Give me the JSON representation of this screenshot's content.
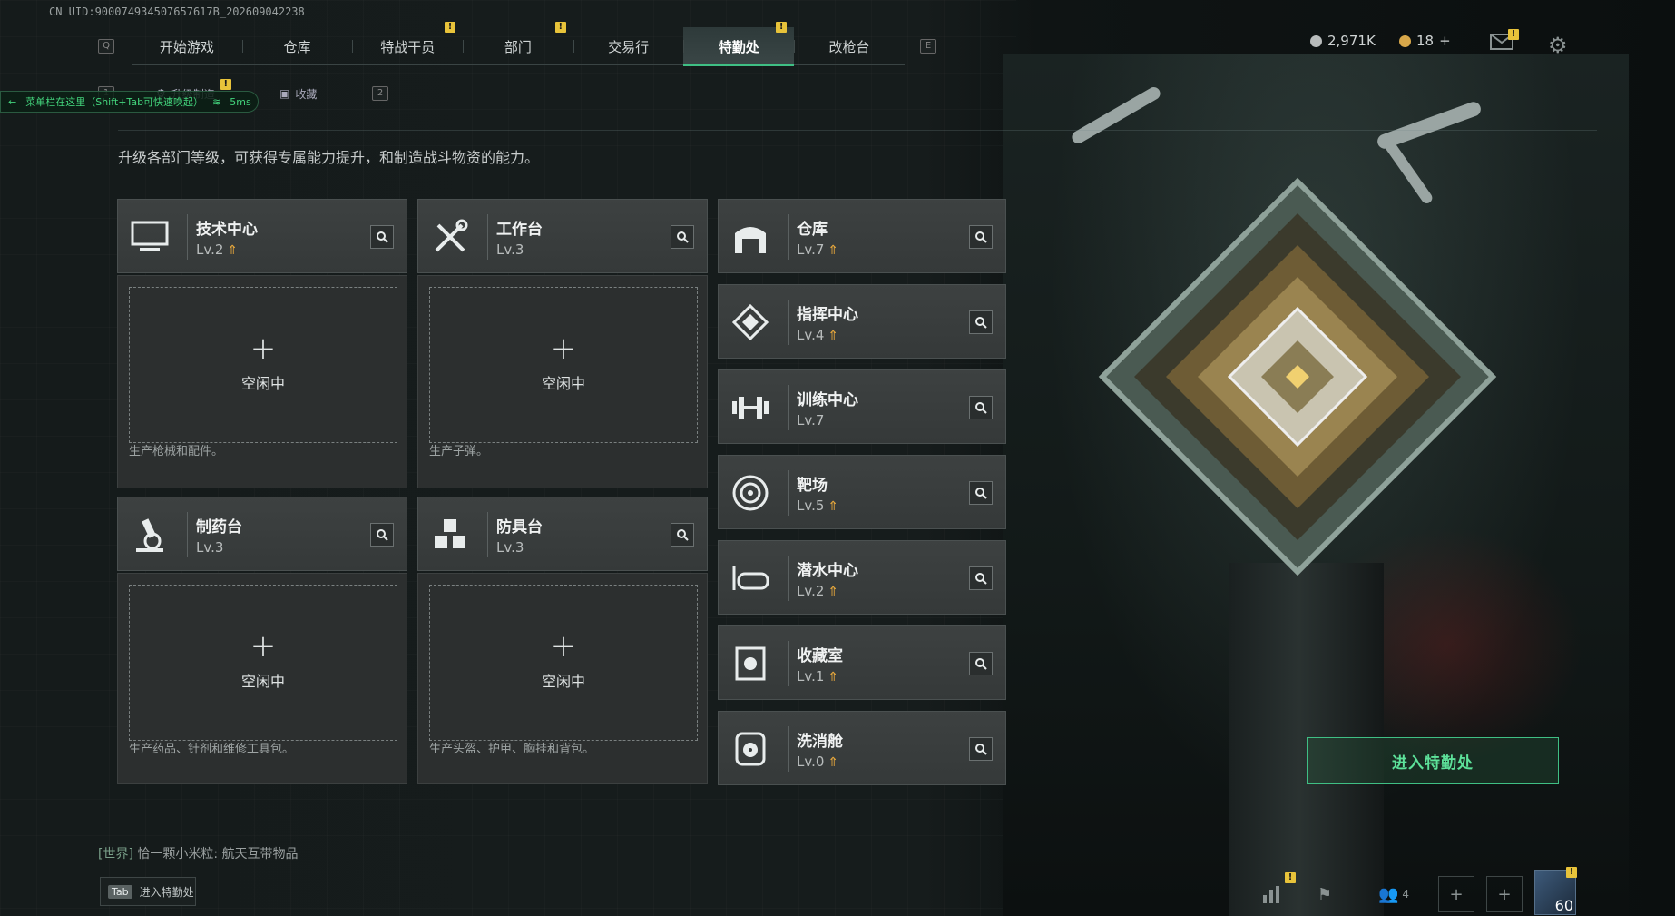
{
  "uid": "CN UID:900074934507657617B_202609042238",
  "nav": {
    "key_left": "Q",
    "key_right": "E",
    "tabs": [
      "开始游戏",
      "仓库",
      "特战干员",
      "部门",
      "交易行",
      "特勤处",
      "改枪台"
    ],
    "active": "特勤处"
  },
  "subnav": {
    "key_left": "1",
    "key_right": "2",
    "upgrade_label": "升级制造",
    "collect_label": "收藏"
  },
  "overlay_tip": {
    "text": "菜单栏在这里（Shift+Tab可快速唤起）",
    "ping": "5ms"
  },
  "currency": {
    "silver": "2,971K",
    "gold": "18",
    "plus": "+"
  },
  "intro": "升级各部门等级，可获得专属能力提升，和制造战斗物资的能力。",
  "production": [
    {
      "name": "技术中心",
      "level": "Lv.2",
      "upgradable": true,
      "icon": "monitor-icon",
      "slot_plus": "+",
      "slot_label": "空闲中",
      "desc": "生产枪械和配件。"
    },
    {
      "name": "工作台",
      "level": "Lv.3",
      "upgradable": false,
      "icon": "tools-icon",
      "slot_plus": "+",
      "slot_label": "空闲中",
      "desc": "生产子弹。"
    },
    {
      "name": "制药台",
      "level": "Lv.3",
      "upgradable": false,
      "icon": "microscope-icon",
      "slot_plus": "+",
      "slot_label": "空闲中",
      "desc": "生产药品、针剂和维修工具包。"
    },
    {
      "name": "防具台",
      "level": "Lv.3",
      "upgradable": false,
      "icon": "cubes-icon",
      "slot_plus": "+",
      "slot_label": "空闲中",
      "desc": "生产头盔、护甲、胸挂和背包。"
    }
  ],
  "facilities": [
    {
      "name": "仓库",
      "level": "Lv.7",
      "upgradable": true,
      "icon": "warehouse-icon"
    },
    {
      "name": "指挥中心",
      "level": "Lv.4",
      "upgradable": true,
      "icon": "command-icon"
    },
    {
      "name": "训练中心",
      "level": "Lv.7",
      "upgradable": false,
      "icon": "dumbbell-icon"
    },
    {
      "name": "靶场",
      "level": "Lv.5",
      "upgradable": true,
      "icon": "target-icon"
    },
    {
      "name": "潜水中心",
      "level": "Lv.2",
      "upgradable": true,
      "icon": "diving-mask-icon"
    },
    {
      "name": "收藏室",
      "level": "Lv.1",
      "upgradable": true,
      "icon": "collection-icon"
    },
    {
      "name": "洗消舱",
      "level": "Lv.0",
      "upgradable": true,
      "icon": "radiation-icon"
    }
  ],
  "enter_button": "进入特勤处",
  "chat": {
    "channel": "[世界]",
    "user": "恰一颗小米粒:",
    "message": "航天互带物品"
  },
  "tab_hint": {
    "key": "Tab",
    "label": "进入特勤处"
  },
  "bottom_right": {
    "squad_count": "4",
    "level": "60"
  },
  "colors": {
    "accent": "#3fbf84",
    "warning": "#e8c33a",
    "upgrade": "#e6a73c"
  }
}
